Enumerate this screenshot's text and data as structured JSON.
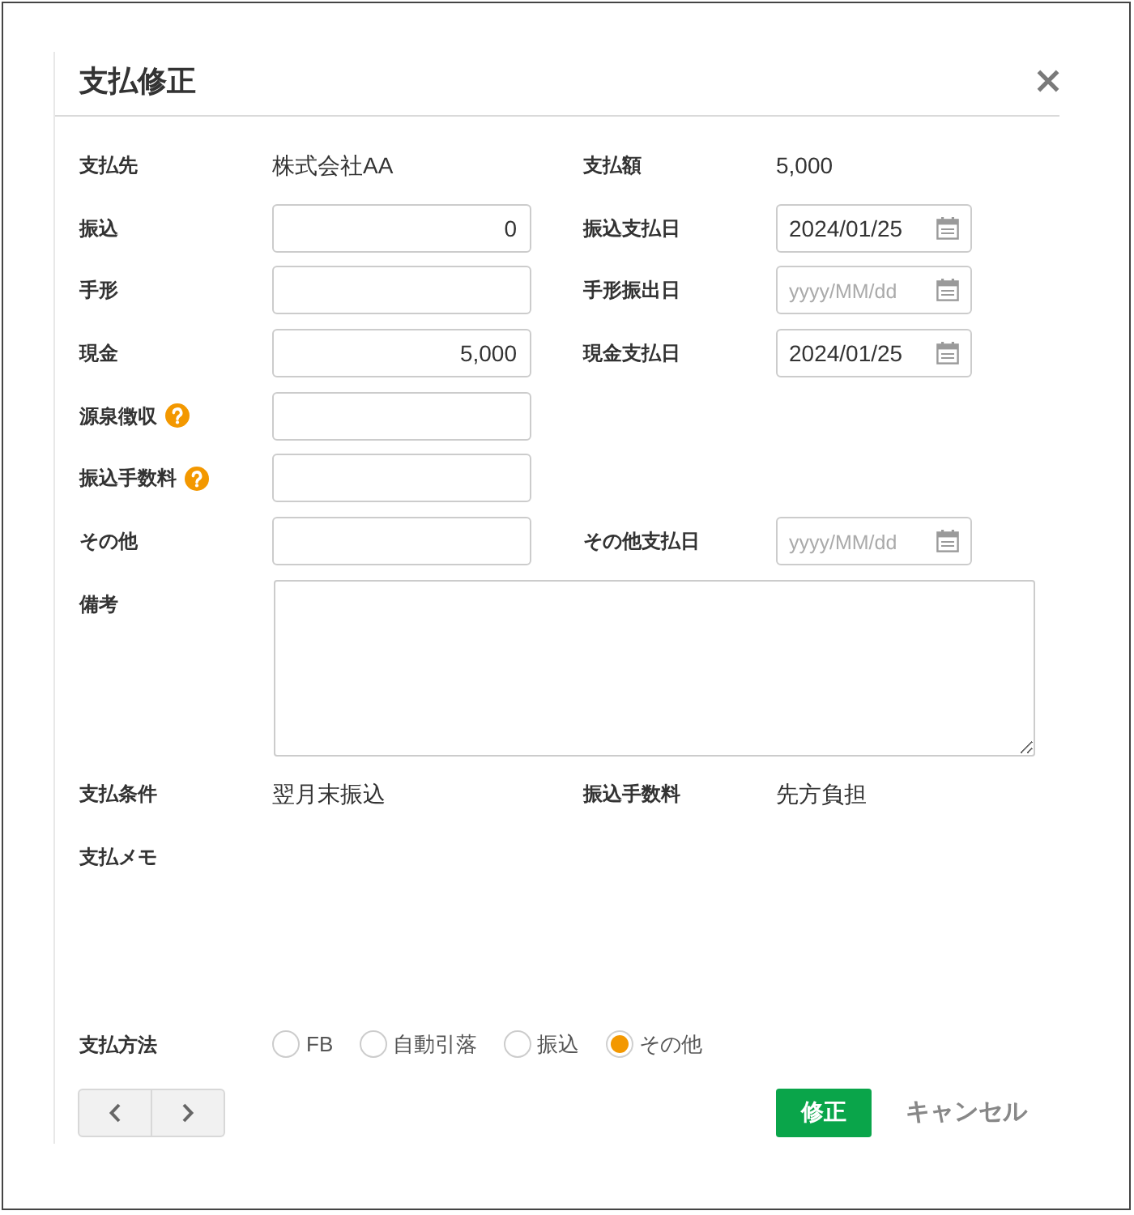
{
  "dialog": {
    "title": "支払修正"
  },
  "rows": [
    {
      "left": {
        "label": "支払先",
        "kind": "text",
        "value": "株式会社AA"
      },
      "right": {
        "label": "支払額",
        "kind": "text",
        "value": "5,000"
      }
    },
    {
      "left": {
        "label": "振込",
        "kind": "amount",
        "value": "0"
      },
      "right": {
        "label": "振込支払日",
        "kind": "date",
        "value": "2024/01/25"
      }
    },
    {
      "left": {
        "label": "手形",
        "kind": "amount"
      },
      "right": {
        "label": "手形振出日",
        "kind": "date",
        "placeholder": "yyyy/MM/dd"
      }
    },
    {
      "left": {
        "label": "現金",
        "kind": "amount",
        "value": "5,000"
      },
      "right": {
        "label": "現金支払日",
        "kind": "date",
        "value": "2024/01/25"
      }
    },
    {
      "left": {
        "label": "源泉徴収",
        "kind": "amount",
        "help": true
      }
    },
    {
      "left": {
        "label": "振込手数料",
        "kind": "amount",
        "help": true
      }
    },
    {
      "left": {
        "label": "その他",
        "kind": "amount"
      },
      "right": {
        "label": "その他支払日",
        "kind": "date",
        "placeholder": "yyyy/MM/dd"
      }
    },
    {
      "left": {
        "label": "備考",
        "kind": "textarea"
      }
    },
    {
      "left": {
        "label": "支払条件",
        "kind": "text",
        "value": "翌月末振込"
      },
      "right": {
        "label": "振込手数料",
        "kind": "text",
        "value": "先方負担"
      }
    },
    {
      "left": {
        "label": "支払メモ",
        "kind": "memo"
      }
    }
  ],
  "payment_method": {
    "label": "支払方法",
    "options": [
      {
        "label": "FB",
        "selected": false
      },
      {
        "label": "自動引落",
        "selected": false
      },
      {
        "label": "振込",
        "selected": false
      },
      {
        "label": "その他",
        "selected": true
      }
    ]
  },
  "footer": {
    "buttons": [
      {
        "label": "修正",
        "kind": "primary"
      },
      {
        "label": "キャンセル",
        "kind": "link"
      }
    ]
  }
}
